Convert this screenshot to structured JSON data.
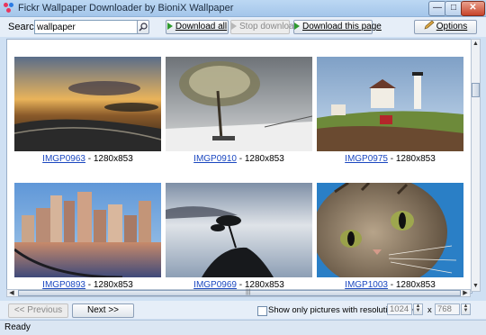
{
  "window": {
    "title": "Fickr Wallpaper Downloader by BioniX Wallpaper"
  },
  "toolbar": {
    "search_label": "Search",
    "search_value": "wallpaper",
    "download_all_label": "Download all",
    "stop_download_label": "Stop download",
    "download_page_label": "Download this page",
    "options_label": "Options"
  },
  "gallery": [
    {
      "name": "IMGP0963",
      "size": " - 1280x853"
    },
    {
      "name": "IMGP0910",
      "size": " - 1280x853"
    },
    {
      "name": "IMGP0975",
      "size": " - 1280x853"
    },
    {
      "name": "IMGP0893",
      "size": " - 1280x853"
    },
    {
      "name": "IMGP0969",
      "size": " - 1280x853"
    },
    {
      "name": "IMGP1003",
      "size": " - 1280x853"
    }
  ],
  "pager": {
    "previous_label": "<< Previous",
    "next_label": "Next >>"
  },
  "filter": {
    "label": "Show only pictures with resolution over :",
    "width_value": "1024",
    "separator": "x",
    "height_value": "768",
    "checked": false
  },
  "status": {
    "text": "Ready"
  }
}
